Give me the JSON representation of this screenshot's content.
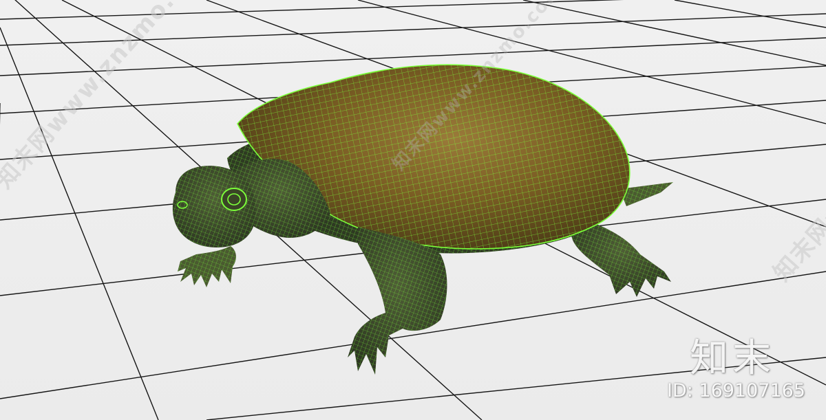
{
  "watermark": {
    "diagonal_text": "知末网www.znzmo.com",
    "brand": "知末",
    "id_text": "ID: 169107165"
  },
  "colors": {
    "background": "#efefef",
    "grid_line": "#111111",
    "wireframe": "#7cff3a",
    "shell": "#8a6a2c",
    "skin": "#3c4a2a"
  }
}
